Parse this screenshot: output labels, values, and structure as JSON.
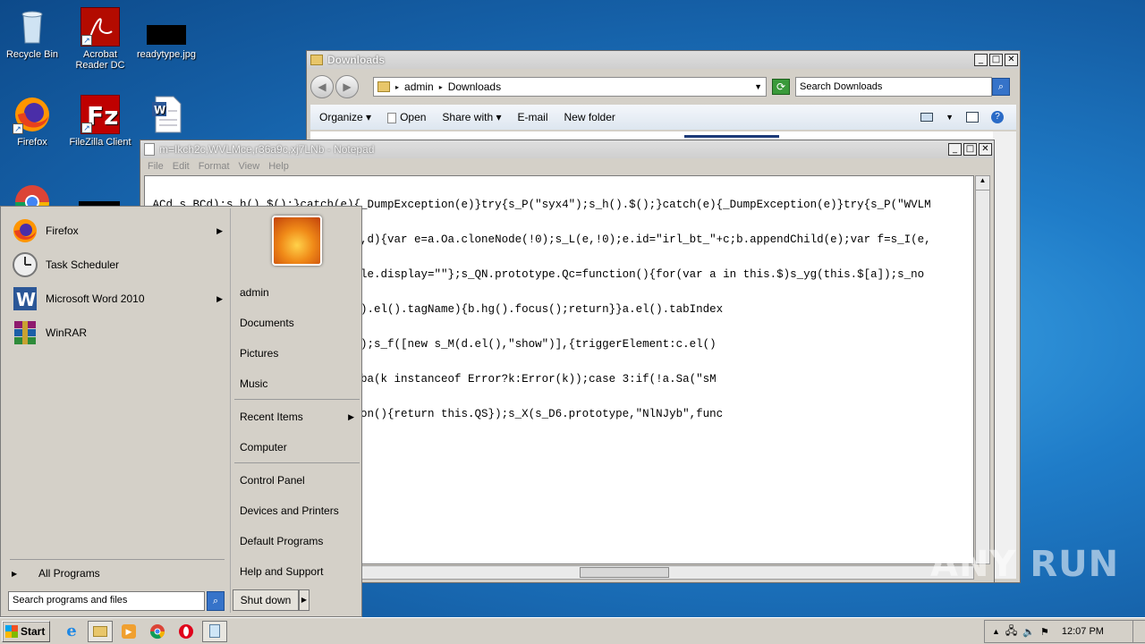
{
  "desktop": {
    "icons": [
      {
        "label": "Recycle Bin",
        "icon": "recycle-bin-icon"
      },
      {
        "label": "Acrobat Reader DC",
        "icon": "acrobat-icon"
      },
      {
        "label": "readytype.jpg",
        "icon": "image-file-icon"
      },
      {
        "label": "Firefox",
        "icon": "firefox-icon"
      },
      {
        "label": "FileZilla Client",
        "icon": "filezilla-icon"
      },
      {
        "label": "",
        "icon": "word-doc-icon"
      }
    ]
  },
  "explorer": {
    "title": "Downloads",
    "path": [
      "admin",
      "Downloads"
    ],
    "search_placeholder": "Search Downloads",
    "commands": [
      "Organize",
      "Open",
      "Share with",
      "E-mail",
      "New folder"
    ]
  },
  "notepad": {
    "title": "m=Ikch2c,WVLMce,r36a9c,xj7LNb - Notepad",
    "menu": [
      "File",
      "Edit",
      "Format",
      "View",
      "Help"
    ],
    "lines": [
      "_ACd,s_BCd);s_h().$();}catch(e){_DumpException(e)}try{s_P(\"syx4\");s_h().$();}catch(e){_DumpException(e)}try{s_P(\"WVLM",
      "+\"px\")};var s_fBd=function(a,b,c,d){var e=a.Oa.cloneNode(!0);s_L(e,!0);e.id=\"irl_bt_\"+c;b.appendChild(e);var f=s_I(e,",
      " style.display=\"none\";this.D.style.display=\"\"};s_QN.prototype.Qc=function(){for(var a in this.$)s_yg(this.$[a]);s_no",
      "_Cwa);if(1==b.size()&&\"A\"==b.hg().el().tagName){b.hg().focus();return}}a.el().tabIndex",
      "_Wl(this,a.targetElement,\"oQYOj\");s_f([new s_M(d.el(),\"show\")],{triggerElement:c.el()",
      "b(g,3);break;case 2:k=s_ub(q),s_ba(k instanceof Error?k:Error(k));case 3:if(!a.Sa(\"sM",
      "_X(s_D6.prototype,\"o7YQ2\",function(){return this.QS});s_X(s_D6.prototype,\"NlNJyb\",func"
    ]
  },
  "start_menu": {
    "programs": [
      {
        "label": "Firefox",
        "icon": "firefox-icon",
        "arrow": true
      },
      {
        "label": "Task Scheduler",
        "icon": "clock-icon",
        "arrow": false
      },
      {
        "label": "Microsoft Word 2010",
        "icon": "word-icon",
        "arrow": true
      },
      {
        "label": "WinRAR",
        "icon": "winrar-icon",
        "arrow": false
      }
    ],
    "all_programs": "All Programs",
    "search_placeholder": "Search programs and files",
    "right_items": [
      "admin",
      "Documents",
      "Pictures",
      "Music",
      "Recent Items",
      "Computer",
      "Control Panel",
      "Devices and Printers",
      "Default Programs",
      "Help and Support"
    ],
    "shutdown": "Shut down"
  },
  "taskbar": {
    "start_label": "Start",
    "pinned": [
      "ie-icon",
      "explorer-icon",
      "media-player-icon",
      "chrome-icon",
      "opera-icon",
      "notepad-icon"
    ],
    "clock": "12:07 PM"
  },
  "watermark": "ANY RUN"
}
